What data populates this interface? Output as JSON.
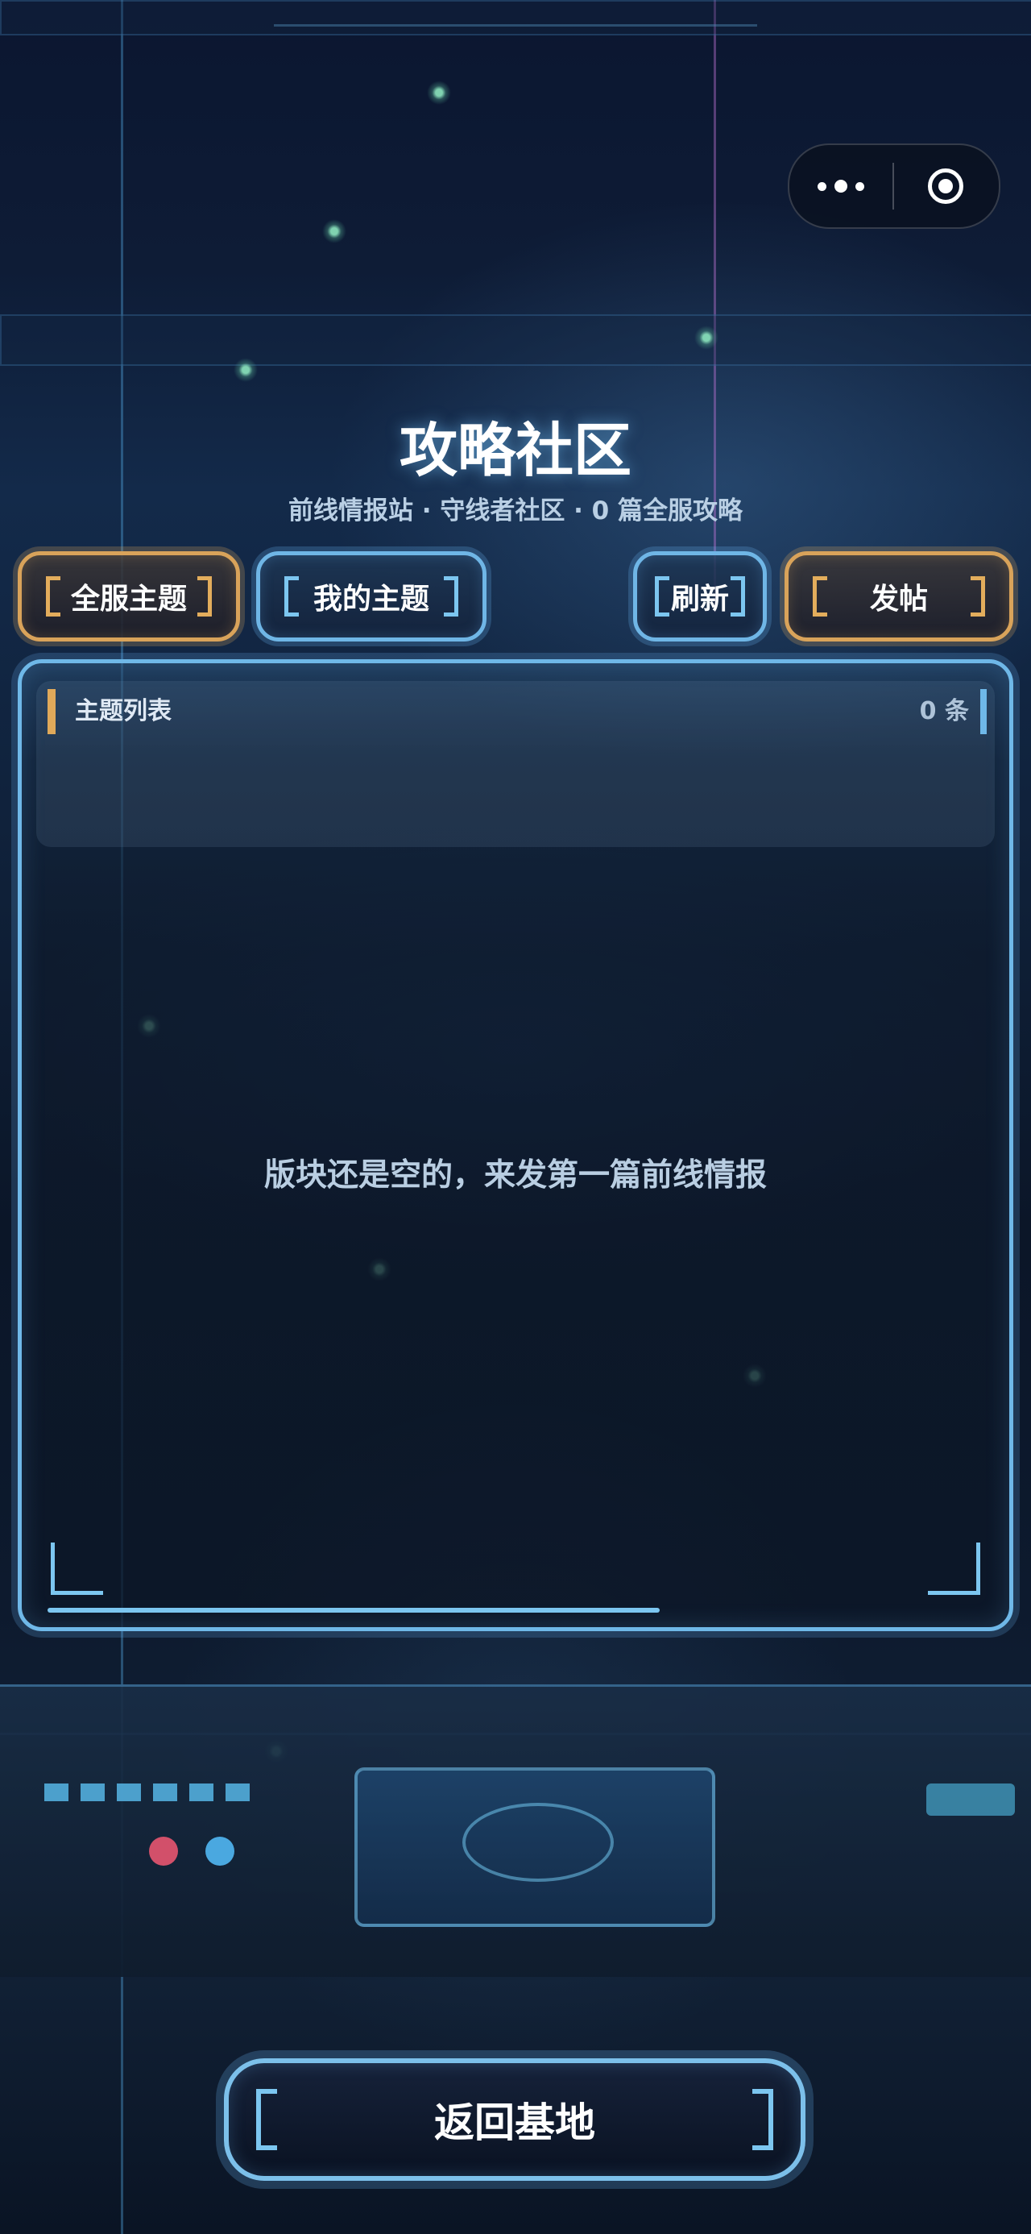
{
  "header": {
    "title": "攻略社区",
    "subtitle": "前线情报站 · 守线者社区 · 0 篇全服攻略"
  },
  "capsule": {
    "more_icon": "more-dots-icon",
    "close_icon": "target-close-icon"
  },
  "filters": {
    "all_topics": "全服主题",
    "my_topics": "我的主题"
  },
  "actions": {
    "refresh": "刷新",
    "post": "发帖"
  },
  "topic_panel": {
    "label": "主题列表",
    "count": "0 条",
    "empty_message": "版块还是空的，来发第一篇前线情报"
  },
  "footer": {
    "back_label": "返回基地"
  },
  "colors": {
    "gold_accent": "#d9a35a",
    "blue_accent": "#6fb6e6",
    "text_primary": "#ffffff",
    "text_secondary": "#b9cfe4"
  }
}
